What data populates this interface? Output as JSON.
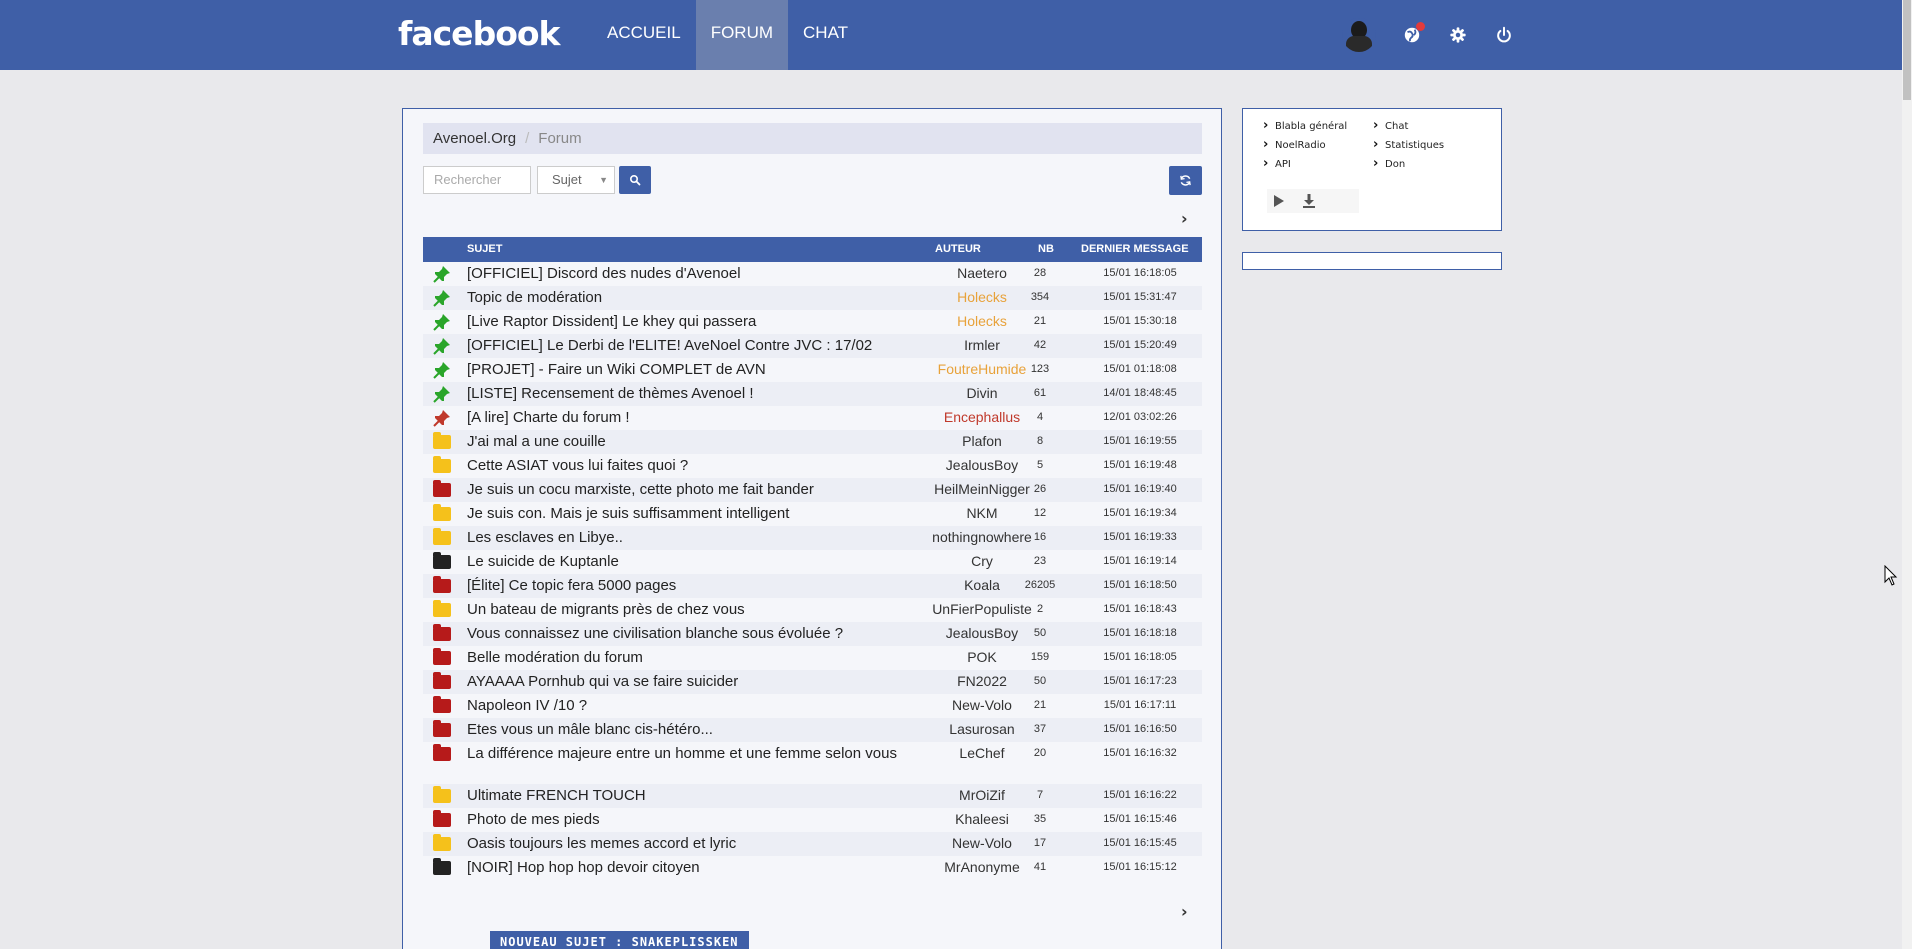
{
  "header": {
    "logo": "facebook",
    "nav": [
      {
        "label": "ACCUEIL",
        "active": false
      },
      {
        "label": "FORUM",
        "active": true
      },
      {
        "label": "CHAT",
        "active": false
      }
    ],
    "icons": [
      "avatar",
      "notifications-globe-icon",
      "settings-gear-icon",
      "power-icon"
    ],
    "accent_color": "#3f5fa7"
  },
  "breadcrumb": {
    "home": "Avenoel.Org",
    "separator": "/",
    "current": "Forum"
  },
  "search": {
    "placeholder": "Rechercher",
    "select_value": "Sujet"
  },
  "table": {
    "headers": {
      "sujet": "SUJET",
      "auteur": "AUTEUR",
      "nb": "NB",
      "dernier": "DERNIER MESSAGE"
    },
    "rows": [
      {
        "icon": "pin-green",
        "subject": "[OFFICIEL] Discord des nudes d'Avenoel",
        "author": "Naetero",
        "author_color": "#333333",
        "nb": "28",
        "date": "15/01 16:18:05"
      },
      {
        "icon": "pin-green",
        "subject": "Topic de modération",
        "author": "Holecks",
        "author_color": "#e8a23a",
        "nb": "354",
        "date": "15/01 15:31:47"
      },
      {
        "icon": "pin-green",
        "subject": "[Live Raptor Dissident] Le khey qui passera",
        "author": "Holecks",
        "author_color": "#e8a23a",
        "nb": "21",
        "date": "15/01 15:30:18"
      },
      {
        "icon": "pin-green",
        "subject": "[OFFICIEL] Le Derbi de l'ELITE! AveNoel Contre JVC : 17/02",
        "author": "Irmler",
        "author_color": "#333333",
        "nb": "42",
        "date": "15/01 15:20:49"
      },
      {
        "icon": "pin-green",
        "subject": "[PROJET] - Faire un Wiki COMPLET de AVN",
        "author": "FoutreHumide",
        "author_color": "#e8a23a",
        "nb": "123",
        "date": "15/01 01:18:08"
      },
      {
        "icon": "pin-green",
        "subject": "[LISTE] Recensement de thèmes Avenoel !",
        "author": "Divin",
        "author_color": "#333333",
        "nb": "61",
        "date": "14/01 18:48:45"
      },
      {
        "icon": "pin-red",
        "subject": "[A lire] Charte du forum !",
        "author": "Encephallus",
        "author_color": "#c0392b",
        "nb": "4",
        "date": "12/01 03:02:26"
      },
      {
        "icon": "folder-yellow",
        "subject": "J'ai mal a une couille",
        "author": "Plafon",
        "author_color": "#333333",
        "nb": "8",
        "date": "15/01 16:19:55"
      },
      {
        "icon": "folder-yellow",
        "subject": "Cette ASIAT vous lui faites quoi ?",
        "author": "JealousBoy",
        "author_color": "#333333",
        "nb": "5",
        "date": "15/01 16:19:48"
      },
      {
        "icon": "folder-red",
        "subject": "Je suis un cocu marxiste, cette photo me fait bander",
        "author": "HeilMeinNigger",
        "author_color": "#333333",
        "nb": "26",
        "date": "15/01 16:19:40"
      },
      {
        "icon": "folder-yellow",
        "subject": "Je suis con. Mais je suis suffisamment intelligent",
        "author": "NKM",
        "author_color": "#333333",
        "nb": "12",
        "date": "15/01 16:19:34"
      },
      {
        "icon": "folder-yellow",
        "subject": "Les esclaves en Libye..",
        "author": "nothingnowhere",
        "author_color": "#333333",
        "nb": "16",
        "date": "15/01 16:19:33"
      },
      {
        "icon": "folder-black",
        "subject": "Le suicide de Kuptanle",
        "author": "Cry",
        "author_color": "#333333",
        "nb": "23",
        "date": "15/01 16:19:14"
      },
      {
        "icon": "folder-red",
        "subject": "[Élite] Ce topic fera 5000 pages",
        "author": "Koala",
        "author_color": "#333333",
        "nb": "26205",
        "date": "15/01 16:18:50"
      },
      {
        "icon": "folder-yellow",
        "subject": "Un bateau de migrants près de chez vous",
        "author": "UnFierPopuliste",
        "author_color": "#333333",
        "nb": "2",
        "date": "15/01 16:18:43"
      },
      {
        "icon": "folder-red",
        "subject": "Vous connaissez une civilisation blanche sous évoluée ?",
        "author": "JealousBoy",
        "author_color": "#333333",
        "nb": "50",
        "date": "15/01 16:18:18"
      },
      {
        "icon": "folder-red",
        "subject": "Belle modération du forum",
        "author": "POK",
        "author_color": "#333333",
        "nb": "159",
        "date": "15/01 16:18:05"
      },
      {
        "icon": "folder-red",
        "subject": "AYAAAA Pornhub qui va se faire suicider",
        "author": "FN2022",
        "author_color": "#333333",
        "nb": "50",
        "date": "15/01 16:17:23"
      },
      {
        "icon": "folder-red",
        "subject": "Napoleon IV /10 ?",
        "author": "New-Volo",
        "author_color": "#333333",
        "nb": "21",
        "date": "15/01 16:17:11"
      },
      {
        "icon": "folder-red",
        "subject": "Etes vous un mâle blanc cis-hétéro...",
        "author": "Lasurosan",
        "author_color": "#333333",
        "nb": "37",
        "date": "15/01 16:16:50"
      },
      {
        "icon": "folder-red",
        "subject": "La différence majeure entre un homme et une femme selon vous",
        "author": "LeChef",
        "author_color": "#333333",
        "nb": "20",
        "date": "15/01 16:16:32",
        "tall": true
      },
      {
        "icon": "folder-yellow",
        "subject": "Ultimate FRENCH TOUCH",
        "author": "MrOiZif",
        "author_color": "#333333",
        "nb": "7",
        "date": "15/01 16:16:22"
      },
      {
        "icon": "folder-red",
        "subject": "Photo de mes pieds",
        "author": "Khaleesi",
        "author_color": "#333333",
        "nb": "35",
        "date": "15/01 16:15:46"
      },
      {
        "icon": "folder-yellow",
        "subject": "Oasis toujours les memes accord et lyric",
        "author": "New-Volo",
        "author_color": "#333333",
        "nb": "17",
        "date": "15/01 16:15:45"
      },
      {
        "icon": "folder-black",
        "subject": "[NOIR] Hop hop hop devoir citoyen",
        "author": "MrAnonyme",
        "author_color": "#333333",
        "nb": "41",
        "date": "15/01 16:15:12"
      }
    ]
  },
  "new_topic_label": "NOUVEAU SUJET : SNAKEPLISSKEN",
  "widget": {
    "links": [
      "Blabla général",
      "Chat",
      "NoelRadio",
      "Statistiques",
      "API",
      "Don"
    ],
    "player_icons": [
      "play-icon",
      "download-icon"
    ]
  }
}
